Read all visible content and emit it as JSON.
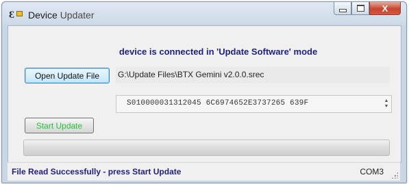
{
  "window": {
    "title_main": "Device",
    "title_sub": "Updater",
    "minimize_label": "",
    "maximize_label": "",
    "close_label": "X"
  },
  "main": {
    "mode_label": "device is connected in 'Update Software' mode",
    "open_button_label": "Open Update File",
    "file_path": "G:\\Update Files\\BTX Gemini v2.0.0.srec",
    "record_value": "S010000031312045 6C6974652E3737265 639F",
    "start_button_label": "Start Update",
    "progress_fraction": 0.0
  },
  "status": {
    "message": "File Read Successfully - press Start Update",
    "port": "COM3"
  },
  "icons": {
    "app": "device-updater-icon",
    "minimize": "minimize-icon",
    "maximize": "maximize-icon",
    "close": "close-icon",
    "spin": "spinner-arrows-icon",
    "grip": "resize-grip-icon"
  },
  "colors": {
    "mode_text": "#202080",
    "start_button_text": "#23c23a",
    "status_text": "#202080"
  }
}
